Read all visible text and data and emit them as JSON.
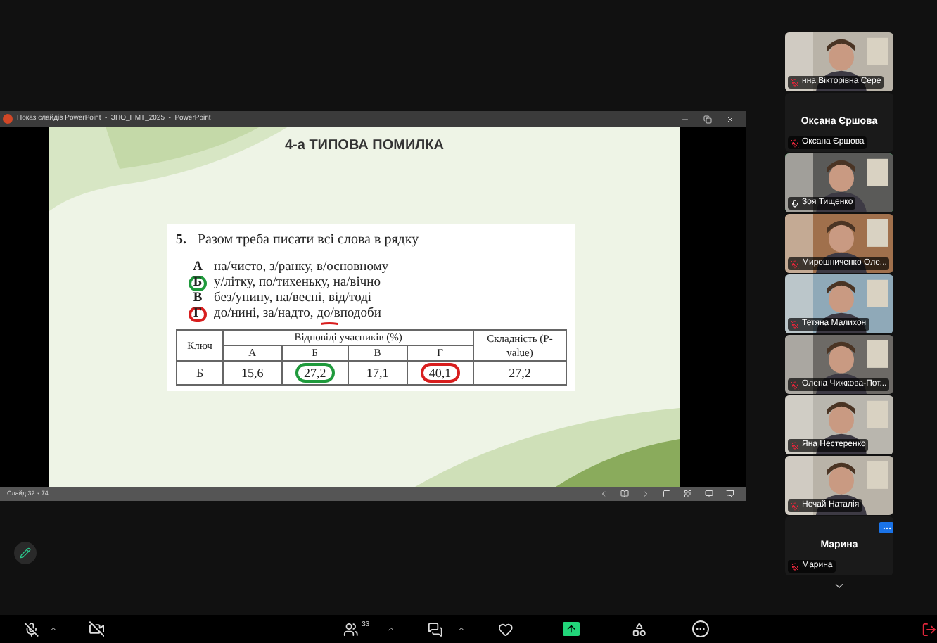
{
  "window": {
    "title": "Показ слайдів PowerPoint  -  ЗНО_НМТ_2025  -  PowerPoint"
  },
  "slide": {
    "title": "4-а ТИПОВА ПОМИЛКА",
    "question": {
      "number": "5.",
      "text": "Разом треба писати всі слова в рядку"
    },
    "options": [
      {
        "letter": "А",
        "circled": false,
        "underline_mark": false,
        "text": "на/чисто, з/ранку, в/основному"
      },
      {
        "letter": "Б",
        "circled": true,
        "color": "#1f9a3c",
        "underline_mark": false,
        "text": "у/літку, по/тихеньку, на/вічно"
      },
      {
        "letter": "В",
        "circled": false,
        "underline_mark": false,
        "text": "без/упину, на/весні, від/тоді"
      },
      {
        "letter": "Г",
        "circled": true,
        "color": "#d81e1e",
        "underline_mark": true,
        "text": "до/нині, за/надто, до/вподоби"
      }
    ],
    "table": {
      "key_header": "Ключ",
      "answers_header": "Відповіді учасників (%)",
      "difficulty_header": "Складність (P-value)",
      "answer_columns": [
        "А",
        "Б",
        "В",
        "Г"
      ],
      "row": {
        "key": "Б",
        "values": [
          {
            "text": "15,6",
            "circled": false
          },
          {
            "text": "27,2",
            "circled": true,
            "color": "#1f9a3c"
          },
          {
            "text": "17,1",
            "circled": false
          },
          {
            "text": "40,1",
            "circled": true,
            "color": "#d81e1e"
          }
        ],
        "difficulty": "27,2"
      }
    }
  },
  "status_bar": {
    "slide_counter": "Слайд 32 з 74"
  },
  "participants": [
    {
      "kind": "video",
      "name": "нна Вікторівна Сере",
      "muted": true,
      "active": false
    },
    {
      "kind": "name_only",
      "display": "Оксана Єршова",
      "name": "Оксана Єршова",
      "muted": true,
      "active": false
    },
    {
      "kind": "video",
      "name": "Зоя Тищенко",
      "muted": false,
      "active": true
    },
    {
      "kind": "video",
      "name": "Мирошниченко Оле...",
      "muted": true,
      "active": false
    },
    {
      "kind": "video",
      "name": "Тетяна Малихон",
      "muted": true,
      "active": false
    },
    {
      "kind": "video",
      "name": "Олена Чижкова-Пот...",
      "muted": true,
      "active": false
    },
    {
      "kind": "video",
      "name": "Яна Нестеренко",
      "muted": true,
      "active": false
    },
    {
      "kind": "video",
      "name": "Нечай Наталія",
      "muted": true,
      "active": false
    },
    {
      "kind": "name_only",
      "display": "Марина",
      "name": "Марина",
      "muted": true,
      "active": false
    }
  ],
  "toolbar": {
    "participants_count": "33"
  }
}
